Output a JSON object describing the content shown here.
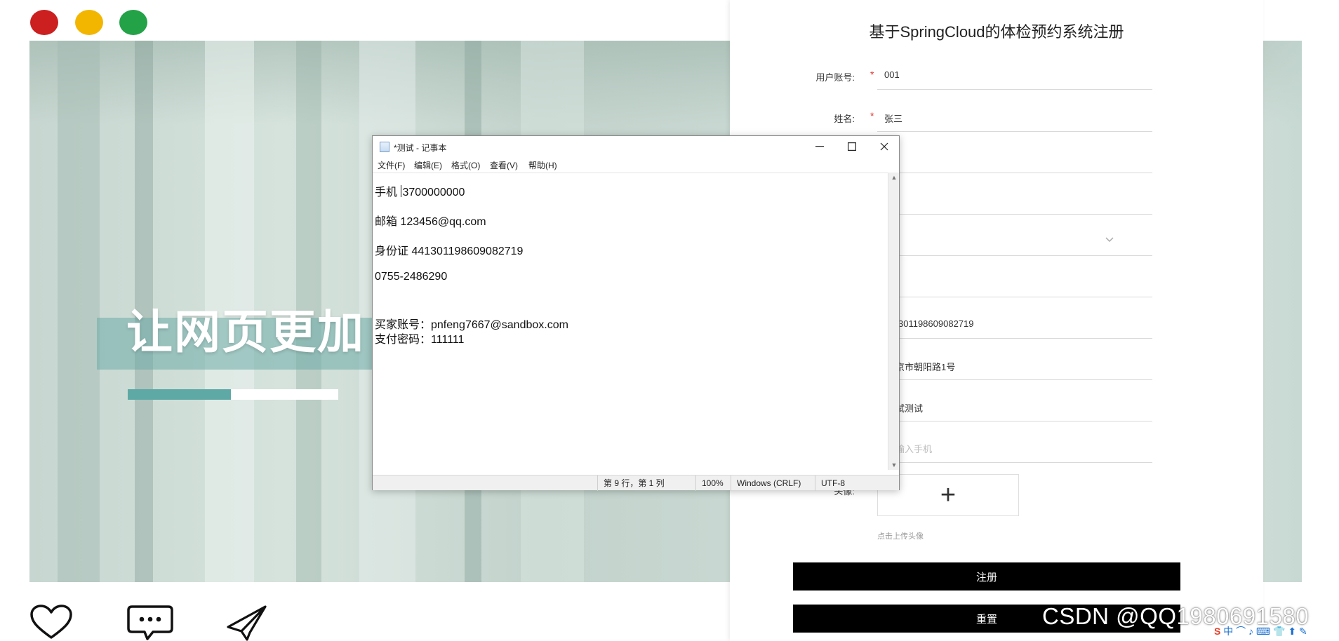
{
  "hero": {
    "headline": "让网页更加",
    "progress_fraction": 0.49
  },
  "register": {
    "title": "基于SpringCloud的体检预约系统注册",
    "fields": [
      {
        "label": "用户账号:",
        "value": "001"
      },
      {
        "label": "姓名:",
        "value": "张三"
      }
    ],
    "partial_values": [
      "301198609082719",
      "京市朝阳路1号",
      "试测试"
    ],
    "phone_placeholder": "输入手机",
    "avatar_label": "头像:",
    "avatar_hint": "点击上传头像",
    "register_button": "注册",
    "reset_button": "重置"
  },
  "notepad": {
    "title": "*测试 - 记事本",
    "menu": [
      "文件(F)",
      "编辑(E)",
      "格式(O)",
      "查看(V)",
      "帮助(H)"
    ],
    "lines": {
      "phone_prefix": "手机 ",
      "phone_rest": "3700000000",
      "email": "邮箱 123456@qq.com",
      "idcard": "身份证 441301198609082719",
      "tel": "0755-2486290",
      "buyer": "买家账号：pnfeng7667@sandbox.com",
      "paypwd": "支付密码：111111"
    },
    "status": {
      "position": "第 9 行，第 1 列",
      "zoom": "100%",
      "eol": "Windows (CRLF)",
      "encoding": "UTF-8"
    }
  },
  "watermark": "CSDN @QQ1980691580",
  "tray": "中 ⌒ ♪ ⌨ 👕 ⬆ ✎",
  "tray_logo": "S",
  "colors": {
    "accent": "#5ea9a6",
    "button": "#000000",
    "required": "#e0342f"
  }
}
